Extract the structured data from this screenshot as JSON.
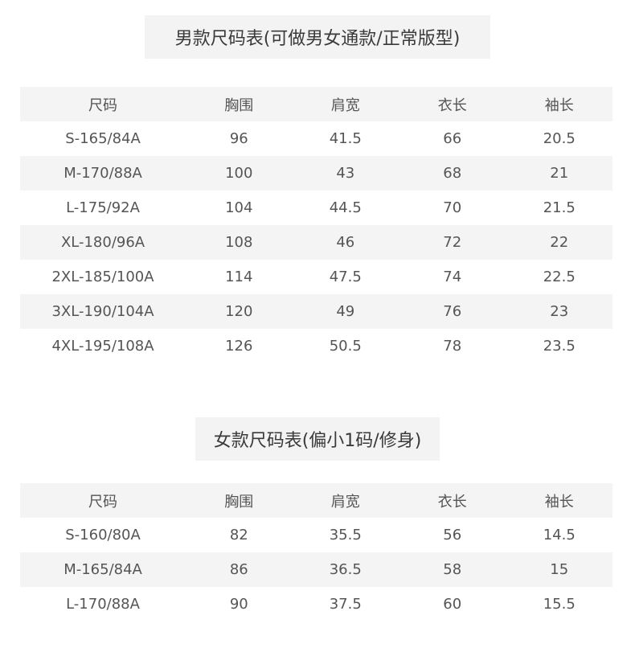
{
  "men": {
    "title": "男款尺码表(可做男女通款/正常版型)",
    "headers": [
      "尺码",
      "胸围",
      "肩宽",
      "衣长",
      "袖长"
    ],
    "rows": [
      [
        "S-165/84A",
        "96",
        "41.5",
        "66",
        "20.5"
      ],
      [
        "M-170/88A",
        "100",
        "43",
        "68",
        "21"
      ],
      [
        "L-175/92A",
        "104",
        "44.5",
        "70",
        "21.5"
      ],
      [
        "XL-180/96A",
        "108",
        "46",
        "72",
        "22"
      ],
      [
        "2XL-185/100A",
        "114",
        "47.5",
        "74",
        "22.5"
      ],
      [
        "3XL-190/104A",
        "120",
        "49",
        "76",
        "23"
      ],
      [
        "4XL-195/108A",
        "126",
        "50.5",
        "78",
        "23.5"
      ]
    ]
  },
  "women": {
    "title": "女款尺码表(偏小1码/修身)",
    "headers": [
      "尺码",
      "胸围",
      "肩宽",
      "衣长",
      "袖长"
    ],
    "rows": [
      [
        "S-160/80A",
        "82",
        "35.5",
        "56",
        "14.5"
      ],
      [
        "M-165/84A",
        "86",
        "36.5",
        "58",
        "15"
      ],
      [
        "L-170/88A",
        "90",
        "37.5",
        "60",
        "15.5"
      ]
    ]
  },
  "colors": {
    "shade": "#f4f4f4",
    "text": "#555555",
    "title_bg": "#f3f3f3"
  }
}
